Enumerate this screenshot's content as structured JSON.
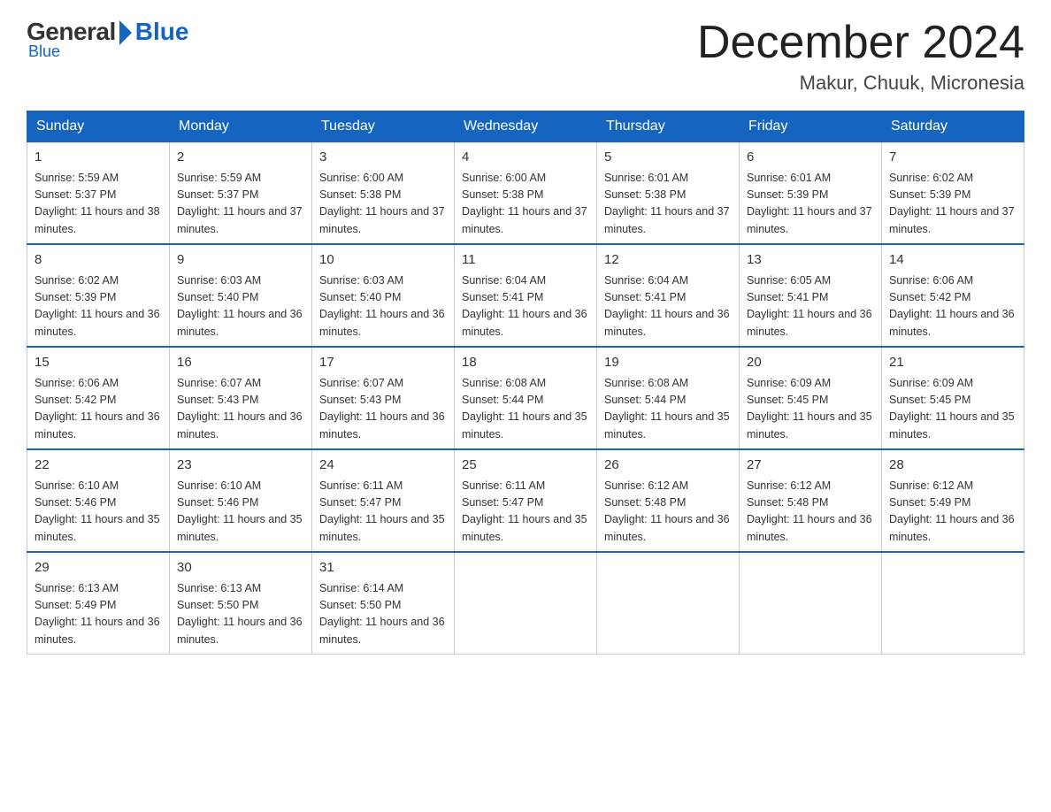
{
  "header": {
    "logo_general": "General",
    "logo_blue": "Blue",
    "month_title": "December 2024",
    "location": "Makur, Chuuk, Micronesia"
  },
  "days_of_week": [
    "Sunday",
    "Monday",
    "Tuesday",
    "Wednesday",
    "Thursday",
    "Friday",
    "Saturday"
  ],
  "weeks": [
    [
      {
        "day": "1",
        "sunrise": "5:59 AM",
        "sunset": "5:37 PM",
        "daylight": "11 hours and 38 minutes."
      },
      {
        "day": "2",
        "sunrise": "5:59 AM",
        "sunset": "5:37 PM",
        "daylight": "11 hours and 37 minutes."
      },
      {
        "day": "3",
        "sunrise": "6:00 AM",
        "sunset": "5:38 PM",
        "daylight": "11 hours and 37 minutes."
      },
      {
        "day": "4",
        "sunrise": "6:00 AM",
        "sunset": "5:38 PM",
        "daylight": "11 hours and 37 minutes."
      },
      {
        "day": "5",
        "sunrise": "6:01 AM",
        "sunset": "5:38 PM",
        "daylight": "11 hours and 37 minutes."
      },
      {
        "day": "6",
        "sunrise": "6:01 AM",
        "sunset": "5:39 PM",
        "daylight": "11 hours and 37 minutes."
      },
      {
        "day": "7",
        "sunrise": "6:02 AM",
        "sunset": "5:39 PM",
        "daylight": "11 hours and 37 minutes."
      }
    ],
    [
      {
        "day": "8",
        "sunrise": "6:02 AM",
        "sunset": "5:39 PM",
        "daylight": "11 hours and 36 minutes."
      },
      {
        "day": "9",
        "sunrise": "6:03 AM",
        "sunset": "5:40 PM",
        "daylight": "11 hours and 36 minutes."
      },
      {
        "day": "10",
        "sunrise": "6:03 AM",
        "sunset": "5:40 PM",
        "daylight": "11 hours and 36 minutes."
      },
      {
        "day": "11",
        "sunrise": "6:04 AM",
        "sunset": "5:41 PM",
        "daylight": "11 hours and 36 minutes."
      },
      {
        "day": "12",
        "sunrise": "6:04 AM",
        "sunset": "5:41 PM",
        "daylight": "11 hours and 36 minutes."
      },
      {
        "day": "13",
        "sunrise": "6:05 AM",
        "sunset": "5:41 PM",
        "daylight": "11 hours and 36 minutes."
      },
      {
        "day": "14",
        "sunrise": "6:06 AM",
        "sunset": "5:42 PM",
        "daylight": "11 hours and 36 minutes."
      }
    ],
    [
      {
        "day": "15",
        "sunrise": "6:06 AM",
        "sunset": "5:42 PM",
        "daylight": "11 hours and 36 minutes."
      },
      {
        "day": "16",
        "sunrise": "6:07 AM",
        "sunset": "5:43 PM",
        "daylight": "11 hours and 36 minutes."
      },
      {
        "day": "17",
        "sunrise": "6:07 AM",
        "sunset": "5:43 PM",
        "daylight": "11 hours and 36 minutes."
      },
      {
        "day": "18",
        "sunrise": "6:08 AM",
        "sunset": "5:44 PM",
        "daylight": "11 hours and 35 minutes."
      },
      {
        "day": "19",
        "sunrise": "6:08 AM",
        "sunset": "5:44 PM",
        "daylight": "11 hours and 35 minutes."
      },
      {
        "day": "20",
        "sunrise": "6:09 AM",
        "sunset": "5:45 PM",
        "daylight": "11 hours and 35 minutes."
      },
      {
        "day": "21",
        "sunrise": "6:09 AM",
        "sunset": "5:45 PM",
        "daylight": "11 hours and 35 minutes."
      }
    ],
    [
      {
        "day": "22",
        "sunrise": "6:10 AM",
        "sunset": "5:46 PM",
        "daylight": "11 hours and 35 minutes."
      },
      {
        "day": "23",
        "sunrise": "6:10 AM",
        "sunset": "5:46 PM",
        "daylight": "11 hours and 35 minutes."
      },
      {
        "day": "24",
        "sunrise": "6:11 AM",
        "sunset": "5:47 PM",
        "daylight": "11 hours and 35 minutes."
      },
      {
        "day": "25",
        "sunrise": "6:11 AM",
        "sunset": "5:47 PM",
        "daylight": "11 hours and 35 minutes."
      },
      {
        "day": "26",
        "sunrise": "6:12 AM",
        "sunset": "5:48 PM",
        "daylight": "11 hours and 36 minutes."
      },
      {
        "day": "27",
        "sunrise": "6:12 AM",
        "sunset": "5:48 PM",
        "daylight": "11 hours and 36 minutes."
      },
      {
        "day": "28",
        "sunrise": "6:12 AM",
        "sunset": "5:49 PM",
        "daylight": "11 hours and 36 minutes."
      }
    ],
    [
      {
        "day": "29",
        "sunrise": "6:13 AM",
        "sunset": "5:49 PM",
        "daylight": "11 hours and 36 minutes."
      },
      {
        "day": "30",
        "sunrise": "6:13 AM",
        "sunset": "5:50 PM",
        "daylight": "11 hours and 36 minutes."
      },
      {
        "day": "31",
        "sunrise": "6:14 AM",
        "sunset": "5:50 PM",
        "daylight": "11 hours and 36 minutes."
      },
      null,
      null,
      null,
      null
    ]
  ],
  "labels": {
    "sunrise_prefix": "Sunrise: ",
    "sunset_prefix": "Sunset: ",
    "daylight_prefix": "Daylight: "
  }
}
